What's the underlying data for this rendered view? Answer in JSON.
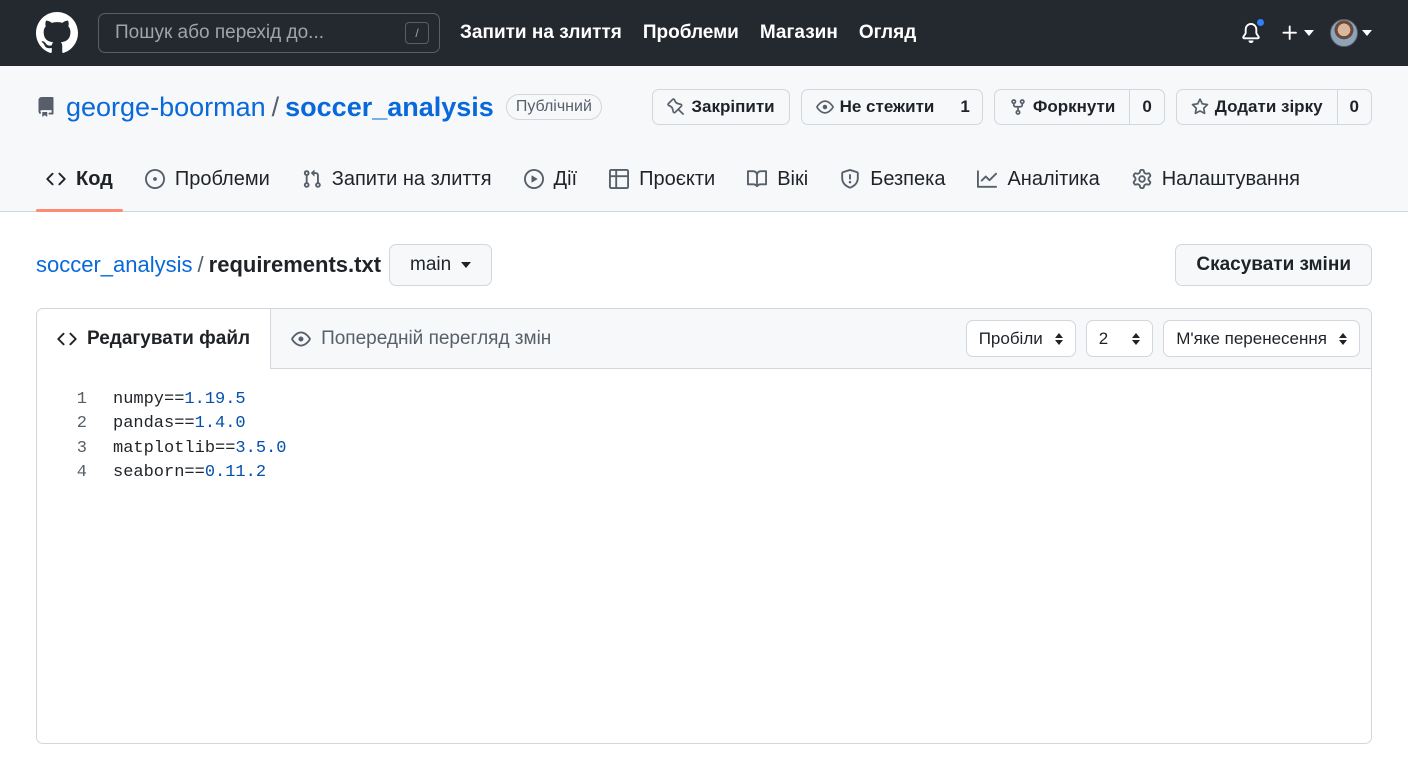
{
  "header": {
    "search_placeholder": "Пошук або перехід до...",
    "search_shortcut": "/",
    "nav": [
      "Запити на злиття",
      "Проблеми",
      "Магазин",
      "Огляд"
    ]
  },
  "repo": {
    "owner": "george-boorman",
    "separator": "/",
    "name": "soccer_analysis",
    "visibility": "Публічний",
    "actions": {
      "pin": "Закріпити",
      "watch": "Не стежити",
      "watch_count": "1",
      "fork": "Форкнути",
      "fork_count": "0",
      "star": "Додати зірку",
      "star_count": "0"
    },
    "tabs": [
      "Код",
      "Проблеми",
      "Запити на злиття",
      "Дії",
      "Проєкти",
      "Вікі",
      "Безпека",
      "Аналітика",
      "Налаштування"
    ]
  },
  "editor_page": {
    "path_repo": "soccer_analysis",
    "path_sep": "/",
    "path_file": "requirements.txt",
    "branch": "main",
    "cancel_label": "Скасувати зміни",
    "tab_edit": "Редагувати файл",
    "tab_preview": "Попередній перегляд змін",
    "indent_mode": "Пробіли",
    "indent_size": "2",
    "wrap_mode": "М'яке перенесення",
    "lines": [
      {
        "n": "1",
        "pkg": "numpy==",
        "ver": "1.19.5"
      },
      {
        "n": "2",
        "pkg": "pandas==",
        "ver": "1.4.0"
      },
      {
        "n": "3",
        "pkg": "matplotlib==",
        "ver": "3.5.0"
      },
      {
        "n": "4",
        "pkg": "seaborn==",
        "ver": "0.11.2"
      }
    ]
  },
  "colors": {
    "header_bg": "#24292f",
    "link": "#0969da",
    "active_tab_underline": "#fd8c73",
    "notification_dot": "#2f81f7"
  }
}
